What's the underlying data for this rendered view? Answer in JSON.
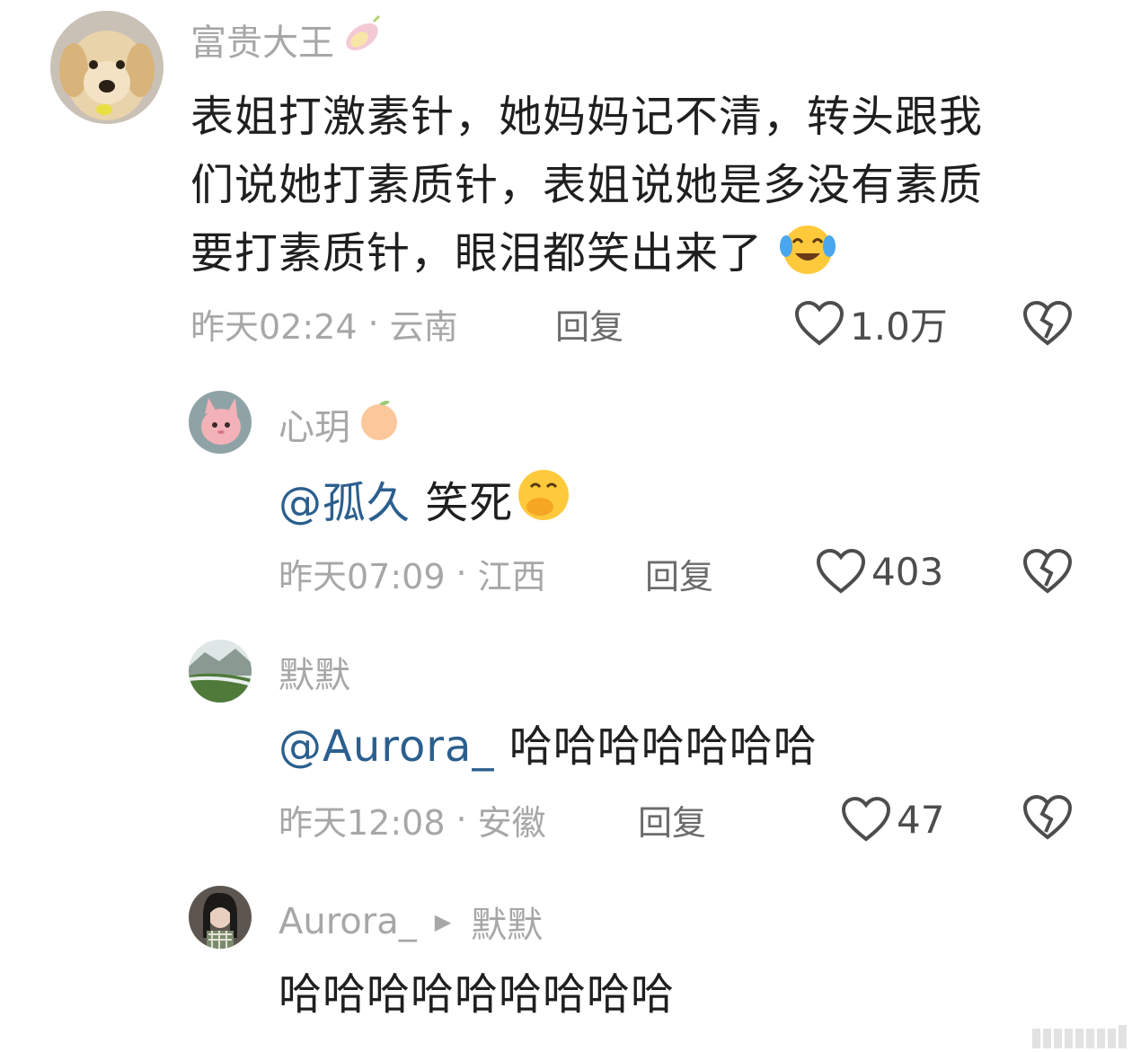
{
  "comments": [
    {
      "username": "富贵大王",
      "name_emoji": "sweet-potato-emoji",
      "mention": "",
      "text_lines": [
        "表姐打激素针，她妈妈记不清，转头跟我",
        "们说她打素质针，表姐说她是多没有素质",
        "要打素质针，眼泪都笑出来了"
      ],
      "trailing_emoji": "crying-laughing-emoji",
      "time": "昨天02:24",
      "location": "云南",
      "reply_label": "回复",
      "likes": "1.0万"
    },
    {
      "username": "心玥",
      "name_emoji": "orange-emoji",
      "mention": "@孤久",
      "text": "笑死",
      "trailing_emoji": "covering-mouth-emoji",
      "time": "昨天07:09",
      "location": "江西",
      "reply_label": "回复",
      "likes": "403"
    },
    {
      "username": "默默",
      "mention": "@Aurora_",
      "text": "哈哈哈哈哈哈哈",
      "time": "昨天12:08",
      "location": "安徽",
      "reply_label": "回复",
      "likes": "47"
    },
    {
      "username": "Aurora_",
      "reply_to": "默默",
      "text": "哈哈哈哈哈哈哈哈哈"
    }
  ],
  "colors": {
    "meta_gray": "#a7a7a7",
    "body_text": "#1f1f1f",
    "mention_blue": "#2b5f8e",
    "icon_dark": "#4d4d4d"
  }
}
